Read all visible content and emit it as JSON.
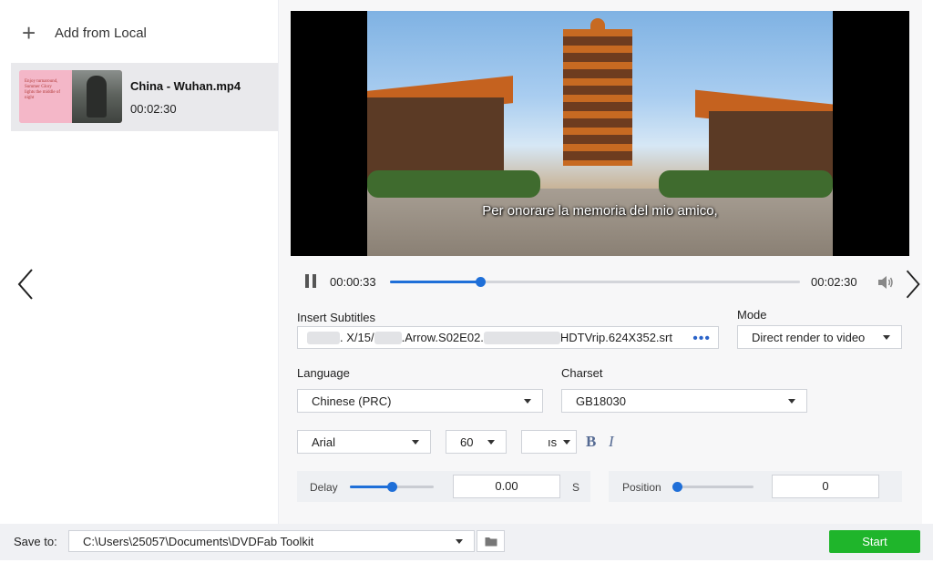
{
  "sidebar": {
    "add_local_label": "Add from Local",
    "files": [
      {
        "name": "China - Wuhan.mp4",
        "duration": "00:02:30",
        "thumb_text": "Enjoy turnaround, Summer Glory lights the middle of night"
      }
    ]
  },
  "player": {
    "subtitle_text": "Per onorare la memoria del mio amico,",
    "current_time": "00:00:33",
    "total_time": "00:02:30",
    "progress_fraction": 0.22
  },
  "subtitles": {
    "insert_label": "Insert Subtitles",
    "file_part1": ". X/15/",
    ".file_part2": ".Arrow.S02E02.",
    "file_part3": "HDTVrip.624X352.srt",
    "browse_icon": "more-dots-icon"
  },
  "mode": {
    "label": "Mode",
    "value": "Direct render to video"
  },
  "language": {
    "label": "Language",
    "value": "Chinese (PRC)"
  },
  "charset": {
    "label": "Charset",
    "value": "GB18030"
  },
  "font": {
    "family": "Arial",
    "size": "60",
    "color_value": "ıs",
    "bold_label": "B",
    "italic_label": "I"
  },
  "delay": {
    "label": "Delay",
    "value": "0.00",
    "unit": "S",
    "slider_fraction": 0.5
  },
  "position": {
    "label": "Position",
    "value": "0",
    "slider_fraction": 0.0
  },
  "footer": {
    "save_label": "Save to:",
    "path": "C:\\Users\\25057\\Documents\\DVDFab Toolkit",
    "start_label": "Start"
  },
  "colors": {
    "accent": "#1f6fd8",
    "start": "#1fb52b"
  }
}
